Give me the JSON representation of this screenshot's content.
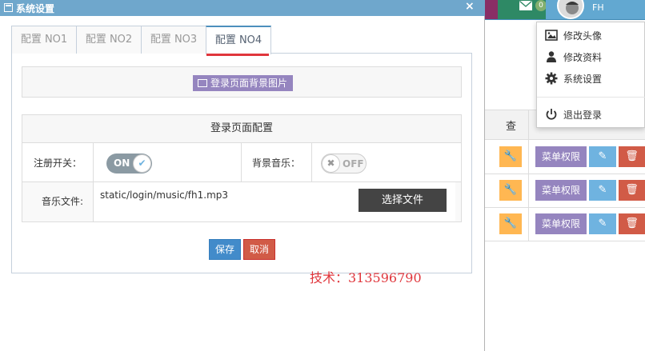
{
  "colors": {
    "title_bar": "#6fa7cc",
    "tab_underline": "#e0363c",
    "purple_button": "#9585bf",
    "save_button": "#428bca",
    "cancel_button": "#d15b47",
    "dark_button": "#444444",
    "wrench_button": "#ffb752",
    "edit_button": "#6fb3e0",
    "topbar_blue": "#438eb9",
    "tech_text": "#e0363c"
  },
  "header": {
    "username": "FH",
    "mail_badge": "0"
  },
  "user_menu": {
    "items": [
      {
        "label": "修改头像",
        "icon": "picture-icon"
      },
      {
        "label": "修改资料",
        "icon": "user-icon"
      },
      {
        "label": "系统设置",
        "icon": "gear-icon"
      },
      {
        "label": "退出登录",
        "icon": "power-icon"
      }
    ]
  },
  "background_table": {
    "header_partial": "查",
    "row_button_label": "菜单权限",
    "rows": 3
  },
  "dialog": {
    "title": "系统设置",
    "close": "×",
    "tabs": [
      {
        "label": "配置 NO1",
        "active": false
      },
      {
        "label": "配置 NO2",
        "active": false
      },
      {
        "label": "配置 NO3",
        "active": false
      },
      {
        "label": "配置 NO4",
        "active": true
      }
    ],
    "bg_image_button": "登录页面背景图片",
    "config": {
      "title": "登录页面配置",
      "register_label": "注册开关：",
      "register_state": "ON",
      "music_label": "背景音乐：",
      "music_state": "OFF",
      "file_label": "音乐文件:",
      "file_path": "static/login/music/fh1.mp3",
      "choose_file": "选择文件"
    },
    "save": "保存",
    "cancel": "取消"
  },
  "tech_note": "技术：313596790"
}
